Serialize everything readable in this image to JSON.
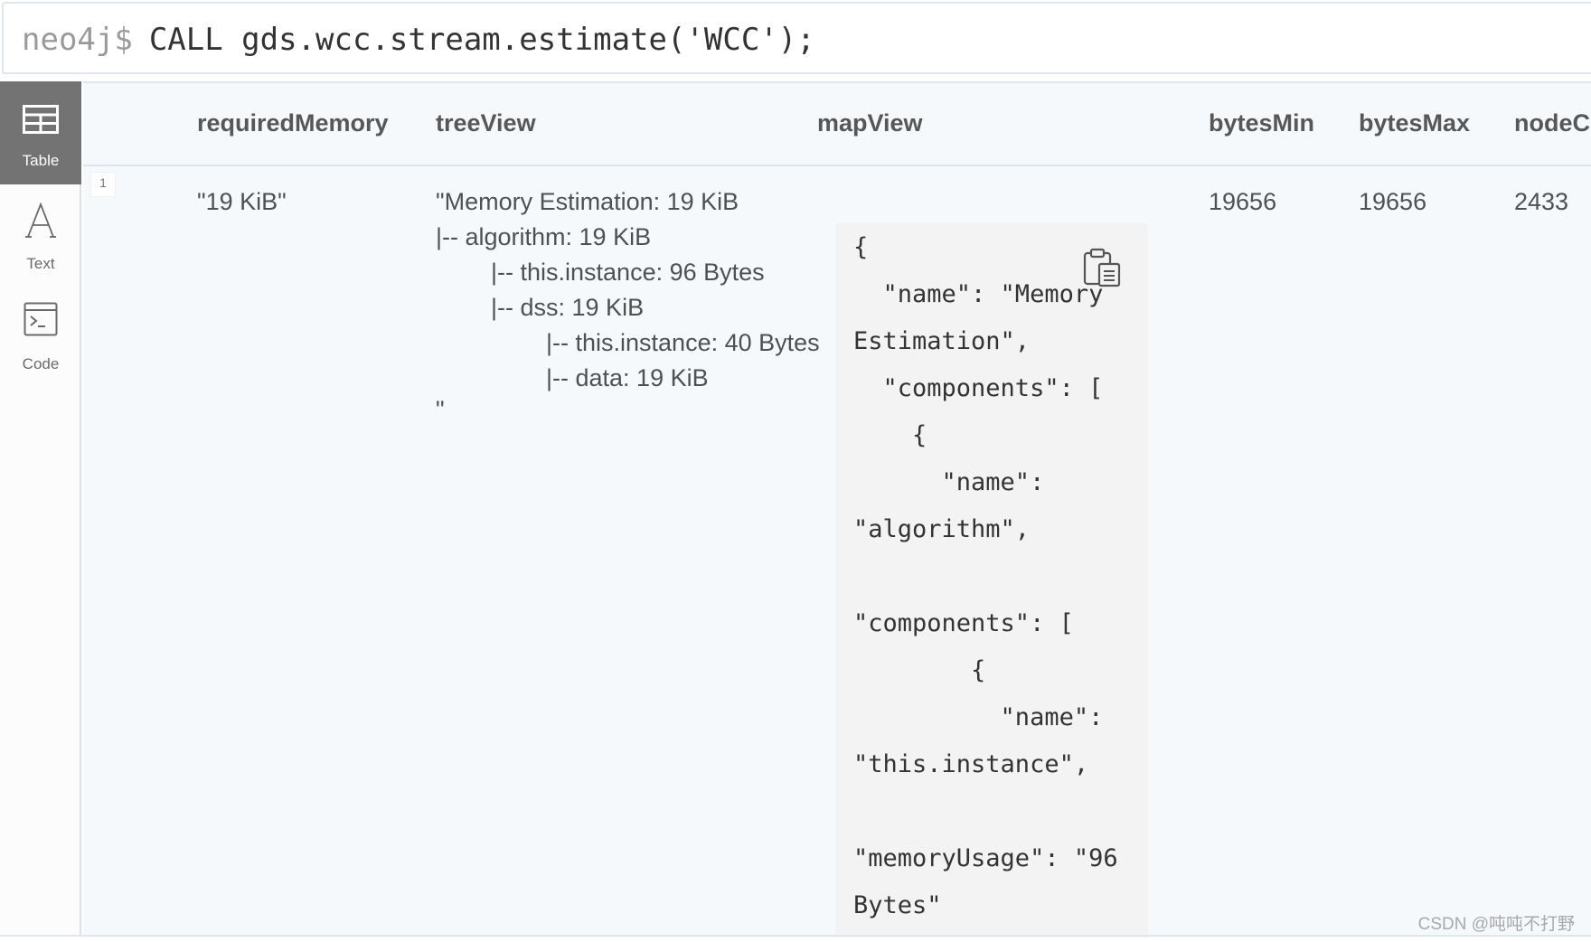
{
  "query": {
    "prompt": "neo4j$",
    "command": "CALL gds.wcc.stream.estimate('WCC');"
  },
  "sidebar": {
    "items": [
      {
        "label": "Table",
        "icon": "table-icon",
        "active": true
      },
      {
        "label": "Text",
        "icon": "text-icon",
        "active": false
      },
      {
        "label": "Code",
        "icon": "code-icon",
        "active": false
      }
    ]
  },
  "table": {
    "columns": [
      "requiredMemory",
      "treeView",
      "mapView",
      "bytesMin",
      "bytesMax",
      "nodeC"
    ],
    "rows": [
      {
        "row_number": "1",
        "requiredMemory": "\"19 KiB\"",
        "treeView": [
          "\"Memory Estimation: 19 KiB",
          "|-- algorithm: 19 KiB",
          "    |-- this.instance: 96 Bytes",
          "    |-- dss: 19 KiB",
          "        |-- this.instance: 40 Bytes",
          "        |-- data: 19 KiB",
          "\""
        ],
        "mapView": [
          "{",
          "  \"name\": \"Memory",
          "Estimation\",",
          "  \"components\": [",
          "    {",
          "      \"name\":",
          "\"algorithm\",",
          "",
          "\"components\": [",
          "        {",
          "          \"name\":",
          "\"this.instance\",",
          "",
          "\"memoryUsage\": \"96",
          "Bytes\""
        ],
        "bytesMin": "19656",
        "bytesMax": "19656",
        "nodeCount": "2433"
      }
    ]
  },
  "watermark": "CSDN @吨吨不打野",
  "colors": {
    "active_tab_bg": "#737373",
    "result_bg": "#f6f9fc",
    "code_bg": "#f3f3f3"
  }
}
